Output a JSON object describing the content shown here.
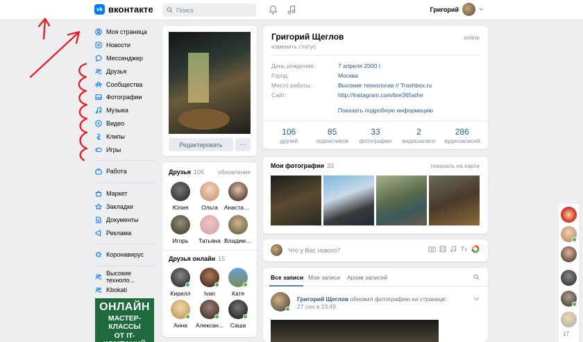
{
  "header": {
    "logo_text": "вконтакте",
    "logo_mark": "vk",
    "search_placeholder": "Поиск",
    "user_name": "Григорий",
    "icons": [
      "bell-icon",
      "music-note-icon",
      "chevron-down-icon"
    ]
  },
  "sidebar": {
    "items": [
      {
        "label": "Моя страница",
        "icon": "user-icon"
      },
      {
        "label": "Новости",
        "icon": "news-icon"
      },
      {
        "label": "Мессенджер",
        "icon": "chat-icon"
      },
      {
        "label": "Друзья",
        "icon": "friends-icon"
      },
      {
        "label": "Сообщества",
        "icon": "communities-icon"
      },
      {
        "label": "Фотографии",
        "icon": "photo-icon"
      },
      {
        "label": "Музыка",
        "icon": "music-icon"
      },
      {
        "label": "Видео",
        "icon": "video-icon"
      },
      {
        "label": "Клипы",
        "icon": "clips-icon"
      },
      {
        "label": "Игры",
        "icon": "games-icon"
      }
    ],
    "work": {
      "label": "Работа",
      "icon": "work-icon"
    },
    "items2": [
      {
        "label": "Маркет",
        "icon": "market-icon"
      },
      {
        "label": "Закладки",
        "icon": "star-icon"
      },
      {
        "label": "Документы",
        "icon": "document-icon"
      },
      {
        "label": "Реклама",
        "icon": "ads-icon"
      }
    ],
    "corona": {
      "label": "Коронавирус",
      "icon": "virus-icon"
    },
    "groups": [
      {
        "label": "Высокие техноло...",
        "icon": "group-icon"
      },
      {
        "label": "Kbokati",
        "icon": "group-icon"
      }
    ],
    "promo": {
      "line1": "ОНЛАЙН",
      "line2": "МАСТЕР-КЛАССЫ",
      "line3": "ОТ IT-КОМПАНИЙ"
    }
  },
  "photo_card": {
    "edit_label": "Редактировать",
    "more_label": "···"
  },
  "friends": {
    "title": "Друзья",
    "count": "106",
    "link": "обновления",
    "list": [
      "Юлия",
      "Ольга",
      "Анастасия",
      "Игорь",
      "Татьяна",
      "Владимир"
    ],
    "online_title": "Друзья онлайн",
    "online_count": "15",
    "online_list": [
      "Кирилл",
      "Ivan",
      "Катя",
      "Анна",
      "Алексан...",
      "Саша"
    ]
  },
  "profile": {
    "name": "Григорий Щеглов",
    "status": "изменить статус",
    "online": "online",
    "rows": [
      {
        "key": "День рождения:",
        "value": "7 апреля 2000 г."
      },
      {
        "key": "Город:",
        "value": "Москва"
      },
      {
        "key": "Место работы:",
        "value": "Высокие технологии // Trashbox.ru"
      },
      {
        "key": "Сайт:",
        "value": "http://Instagram.com/bre365athe"
      }
    ],
    "details_link": "Показать подробную информацию",
    "counters": [
      {
        "n": "106",
        "l": "друзей"
      },
      {
        "n": "85",
        "l": "подписчиков"
      },
      {
        "n": "33",
        "l": "фотографии"
      },
      {
        "n": "2",
        "l": "видеозаписи"
      },
      {
        "n": "286",
        "l": "аудиозаписей"
      }
    ]
  },
  "photos": {
    "title": "Мои фотографии",
    "count": "33",
    "link": "показать на карте"
  },
  "post_box": {
    "placeholder": "Что у Вас нового?",
    "icons": [
      "camera-icon",
      "video-icon",
      "music-icon",
      "text-format-icon",
      "color-circle-icon"
    ]
  },
  "feed": {
    "tabs": [
      "Все записи",
      "Мои записи",
      "Архив записей"
    ],
    "post": {
      "author": "Григорий Щеглов",
      "action": "обновил фотографию на странице:",
      "time": "27 сен в 23:49"
    }
  },
  "right_rail": {
    "count": "17"
  },
  "colors": {
    "accent": "#0077ff",
    "link": "#2a5885",
    "annotation": "#e8202a",
    "background": "#edeef0"
  }
}
